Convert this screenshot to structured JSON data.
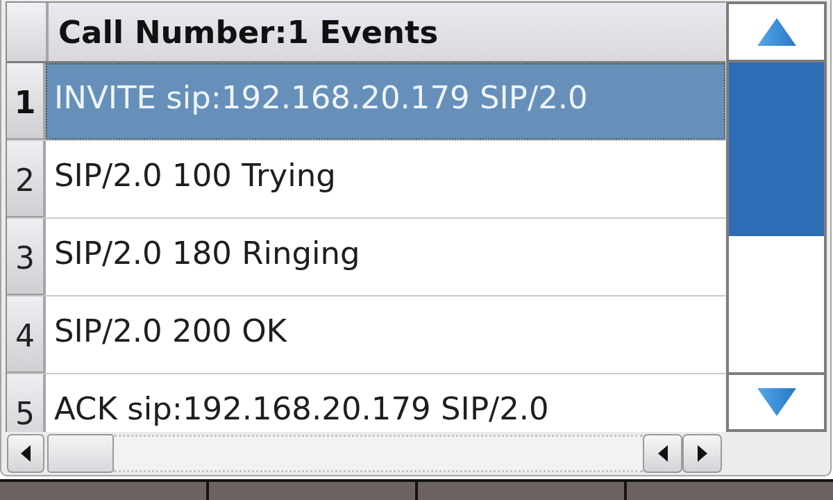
{
  "events_table": {
    "title": "Call Number:1 Events",
    "rows": [
      {
        "number": "1",
        "event": "INVITE sip:192.168.20.179 SIP/2.0",
        "selected": true
      },
      {
        "number": "2",
        "event": "SIP/2.0 100 Trying",
        "selected": false
      },
      {
        "number": "3",
        "event": "SIP/2.0 180 Ringing",
        "selected": false
      },
      {
        "number": "4",
        "event": "SIP/2.0 200 OK",
        "selected": false
      },
      {
        "number": "5",
        "event": "ACK sip:192.168.20.179 SIP/2.0",
        "selected": false
      }
    ]
  }
}
